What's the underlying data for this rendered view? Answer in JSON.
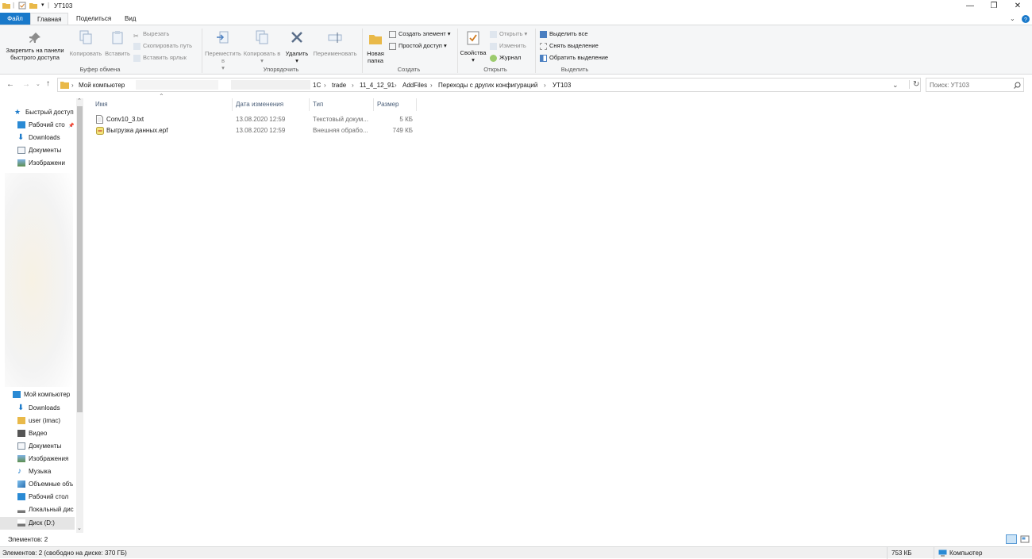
{
  "window": {
    "title": "УТ103",
    "controls": [
      "minimize-icon",
      "restore-icon",
      "close-icon"
    ]
  },
  "tabs": {
    "file": "Файл",
    "home": "Главная",
    "share": "Поделиться",
    "view": "Вид"
  },
  "ribbon": {
    "clipboard": {
      "pin": "Закрепить на панели быстрого доступа",
      "copy": "Копировать",
      "paste": "Вставить",
      "cut": "Вырезать",
      "copy_path": "Скопировать путь",
      "paste_shortcut": "Вставить ярлык",
      "label": "Буфер обмена"
    },
    "organize": {
      "move_to": "Переместить в",
      "copy_to": "Копировать в",
      "delete": "Удалить",
      "rename": "Переименовать",
      "label": "Упорядочить"
    },
    "new": {
      "new_folder": "Новая папка",
      "new_item": "Создать элемент",
      "easy_access": "Простой доступ",
      "label": "Создать"
    },
    "open": {
      "properties": "Свойства",
      "open": "Открыть",
      "edit": "Изменить",
      "history": "Журнал",
      "label": "Открыть"
    },
    "select": {
      "select_all": "Выделить все",
      "select_none": "Снять выделение",
      "invert": "Обратить выделение",
      "label": "Выделить"
    }
  },
  "address": {
    "root": "Мой компьютер",
    "crumbs": [
      "1C",
      "trade",
      "11_4_12_91",
      "AddFiles",
      "Переходы с других конфигураций",
      "УТ103"
    ]
  },
  "search": {
    "placeholder": "Поиск: УТ103"
  },
  "nav": {
    "quick_access": "Быстрый доступ",
    "quick_items": [
      "Рабочий сто",
      "Downloads",
      "Документы",
      "Изображени"
    ],
    "this_pc": "Мой компьютер",
    "pc_items": [
      "Downloads",
      "user (imac)",
      "Видео",
      "Документы",
      "Изображения",
      "Музыка",
      "Объемные объ",
      "Рабочий стол",
      "Локальный дис",
      "Диск (D:)"
    ]
  },
  "columns": {
    "name": "Имя",
    "date": "Дата изменения",
    "type": "Тип",
    "size": "Размер"
  },
  "files": [
    {
      "name": "Conv10_3.txt",
      "date": "13.08.2020 12:59",
      "type": "Текстовый докум...",
      "size": "5 КБ"
    },
    {
      "name": "Выгрузка данных.epf",
      "date": "13.08.2020 12:59",
      "type": "Внешняя обрабо...",
      "size": "749 КБ"
    }
  ],
  "status": {
    "count": "Элементов: 2",
    "bottom_left": "Элементов: 2 (свободно на диске: 370 ГБ)",
    "bottom_size": "753 КБ",
    "bottom_location": "Компьютер"
  }
}
